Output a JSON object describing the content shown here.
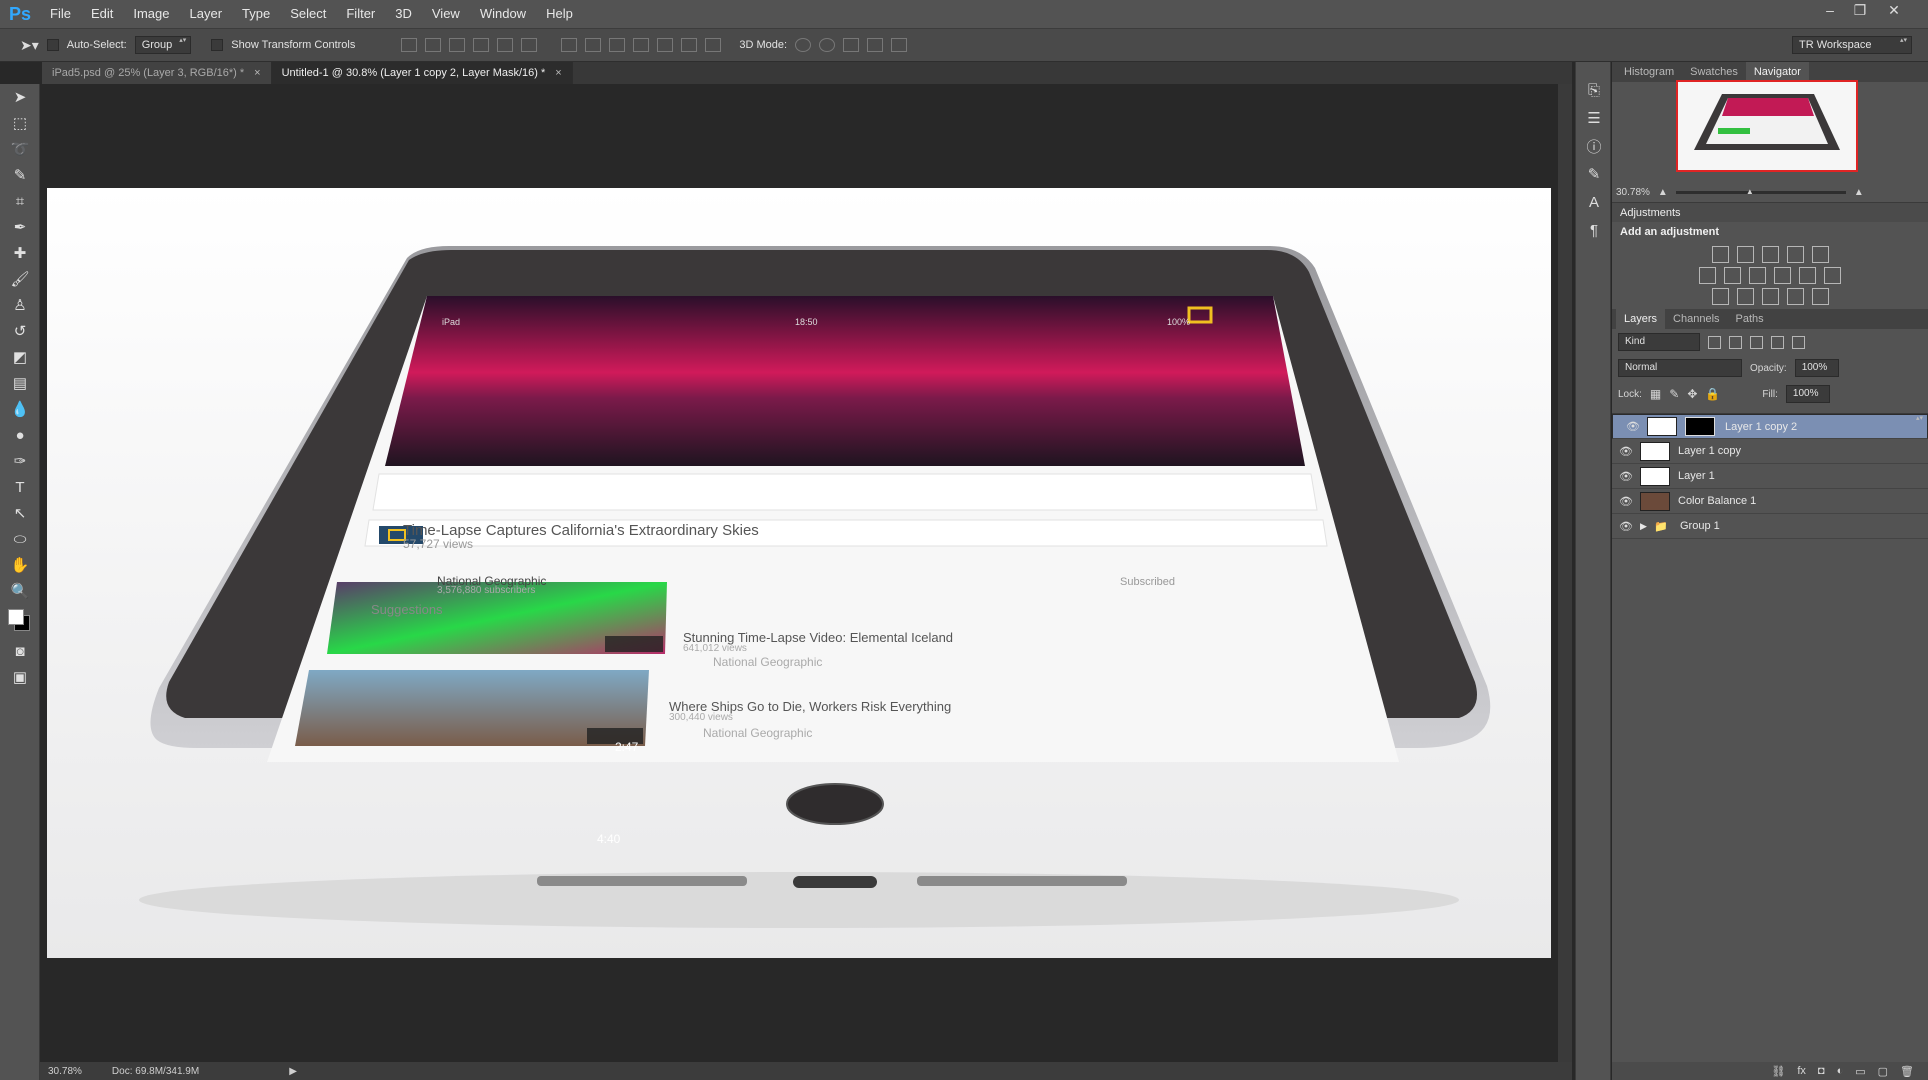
{
  "menubar": {
    "logo": "Ps",
    "items": [
      "File",
      "Edit",
      "Image",
      "Layer",
      "Type",
      "Select",
      "Filter",
      "3D",
      "View",
      "Window",
      "Help"
    ]
  },
  "options": {
    "auto_select_label": "Auto-Select:",
    "auto_select_value": "Group",
    "transform_label": "Show Transform Controls",
    "mode_3d_label": "3D Mode:",
    "workspace": "TR Workspace"
  },
  "tabs": [
    {
      "label": "iPad5.psd @ 25% (Layer 3, RGB/16*) *",
      "close": "×"
    },
    {
      "label": "Untitled-1 @ 30.8% (Layer 1 copy 2, Layer Mask/16) *",
      "close": "×"
    }
  ],
  "canvas": {
    "video_title": "Time-Lapse Captures California's Extraordinary Skies",
    "video_views": "57,727 views",
    "channel": "National Geographic",
    "channel_subs": "3,576,880 subscribers",
    "subscribed": "Subscribed",
    "suggestions_label": "Suggestions",
    "suggestion1_title": "Stunning Time-Lapse Video: Elemental Iceland",
    "suggestion1_views": "641,012 views",
    "suggestion1_channel": "National Geographic",
    "suggestion1_duration": "2:47",
    "suggestion2_title": "Where Ships Go to Die, Workers Risk Everything",
    "suggestion2_views": "300,440 views",
    "suggestion2_channel": "National Geographic",
    "suggestion2_duration": "4:40",
    "status_time": "18:50",
    "status_left": "iPad",
    "status_right": "100%"
  },
  "status": {
    "zoom": "30.78%",
    "doc": "Doc: 69.8M/341.9M"
  },
  "panels": {
    "top_tabs": [
      "Histogram",
      "Swatches",
      "Navigator"
    ],
    "nav_zoom": "30.78%",
    "adjustments_title": "Adjustments",
    "add_adjustment": "Add an adjustment",
    "layer_tabs": [
      "Layers",
      "Channels",
      "Paths"
    ],
    "kind": "Kind",
    "blend_mode": "Normal",
    "opacity_label": "Opacity:",
    "opacity_value": "100%",
    "lock_label": "Lock:",
    "fill_label": "Fill:",
    "fill_value": "100%",
    "layers": [
      {
        "name": "Layer 1 copy 2",
        "selected": true
      },
      {
        "name": "Layer 1 copy",
        "selected": false
      },
      {
        "name": "Layer 1",
        "selected": false
      },
      {
        "name": "Color Balance 1",
        "selected": false
      },
      {
        "name": "Group 1",
        "selected": false
      }
    ]
  }
}
